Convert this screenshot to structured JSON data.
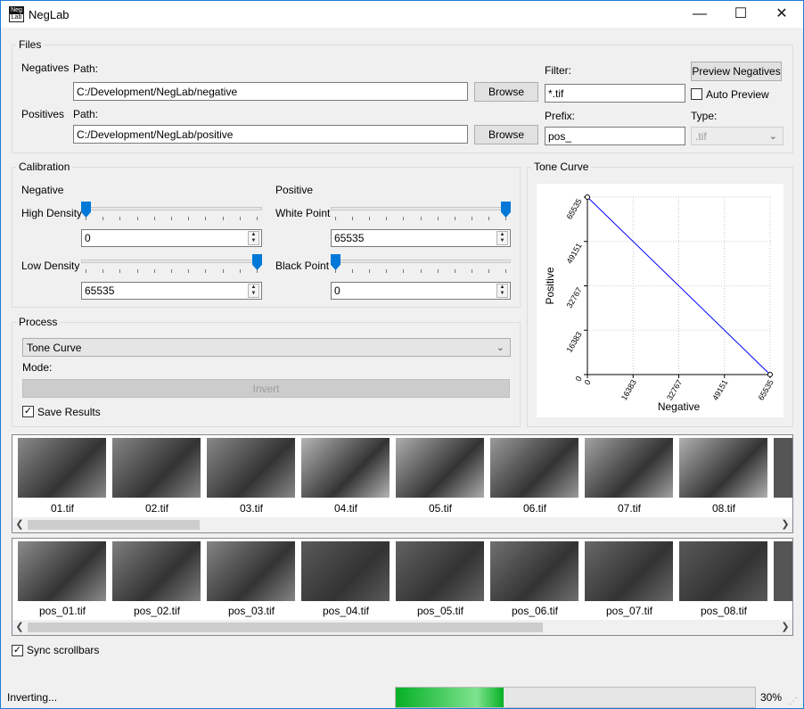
{
  "window": {
    "title": "NegLab",
    "icon_top": "Neg",
    "icon_bottom": "Lab",
    "controls": {
      "minimize": "—",
      "maximize": "☐",
      "close": "✕"
    }
  },
  "files": {
    "group_title": "Files",
    "negatives_label": "Negatives",
    "positives_label": "Positives",
    "path_label": "Path:",
    "negatives_path": "C:/Development/NegLab/negative",
    "positives_path": "C:/Development/NegLab/positive",
    "browse_label": "Browse",
    "filter_label": "Filter:",
    "filter_value": "*.tif",
    "prefix_label": "Prefix:",
    "prefix_value": "pos_",
    "preview_button": "Preview Negatives",
    "auto_preview_label": "Auto Preview",
    "auto_preview_checked": false,
    "type_label": "Type:",
    "type_value": ".tif"
  },
  "calibration": {
    "group_title": "Calibration",
    "negative_label": "Negative",
    "positive_label": "Positive",
    "high_density_label": "High Density",
    "low_density_label": "Low Density",
    "white_point_label": "White Point",
    "black_point_label": "Black Point",
    "high_density_value": "0",
    "low_density_value": "65535",
    "white_point_value": "65535",
    "black_point_value": "0",
    "high_density_level": 0,
    "low_density_level": 1,
    "white_point_level": 1,
    "black_point_level": 0
  },
  "process": {
    "group_title": "Process",
    "mode_select": "Tone Curve",
    "mode_label": "Mode:",
    "invert_button": "Invert",
    "save_results_label": "Save Results",
    "save_results_checked": true
  },
  "tone_curve": {
    "group_title": "Tone Curve"
  },
  "chart_data": {
    "type": "line",
    "title": "",
    "xlabel": "Negative",
    "ylabel": "Positive",
    "xlim": [
      0,
      65535
    ],
    "ylim": [
      0,
      65535
    ],
    "x_ticks": [
      "0",
      "16383",
      "32767",
      "49151",
      "65535"
    ],
    "y_ticks": [
      "0",
      "16383",
      "32767",
      "49151",
      "65535"
    ],
    "grid": true,
    "series": [
      {
        "x": [
          0,
          65535
        ],
        "y": [
          65535,
          0
        ],
        "color": "#0000ff"
      }
    ]
  },
  "negatives_strip": {
    "items": [
      {
        "label": "01.tif",
        "shade": "#8a8a8a"
      },
      {
        "label": "02.tif",
        "shade": "#858585"
      },
      {
        "label": "03.tif",
        "shade": "#888888"
      },
      {
        "label": "04.tif",
        "shade": "#b5b5b5"
      },
      {
        "label": "05.tif",
        "shade": "#adadad"
      },
      {
        "label": "06.tif",
        "shade": "#9a9a9a"
      },
      {
        "label": "07.tif",
        "shade": "#a2a2a2"
      },
      {
        "label": "08.tif",
        "shade": "#b0b0b0"
      }
    ]
  },
  "positives_strip": {
    "items": [
      {
        "label": "pos_01.tif",
        "shade": "#8c8c8c"
      },
      {
        "label": "pos_02.tif",
        "shade": "#7e7e7e"
      },
      {
        "label": "pos_03.tif",
        "shade": "#858585"
      },
      {
        "label": "pos_04.tif",
        "shade": "#5a5a5a"
      },
      {
        "label": "pos_05.tif",
        "shade": "#626262"
      },
      {
        "label": "pos_06.tif",
        "shade": "#707070"
      },
      {
        "label": "pos_07.tif",
        "shade": "#686868"
      },
      {
        "label": "pos_08.tif",
        "shade": "#595959"
      }
    ]
  },
  "sync_scrollbars_label": "Sync scrollbars",
  "sync_scrollbars_checked": true,
  "status": {
    "text": "Inverting...",
    "progress_percent": 30,
    "progress_label": "30%"
  },
  "colors": {
    "accent": "#0078d7",
    "progress": "#06b025",
    "curve": "#0000ff"
  }
}
